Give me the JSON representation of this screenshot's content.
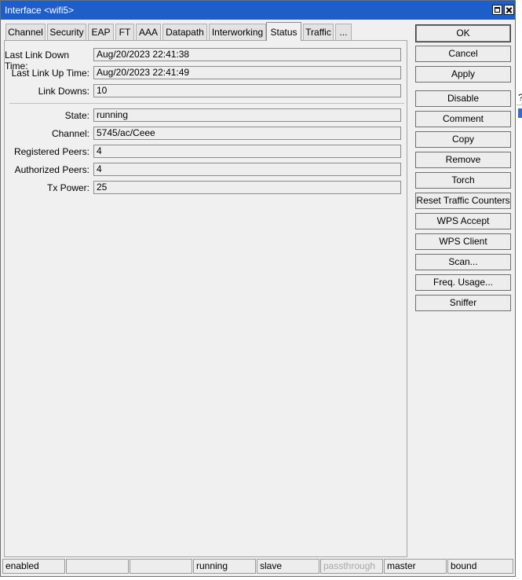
{
  "window": {
    "title": "Interface <wifi5>"
  },
  "tabs": [
    {
      "label": "Channel"
    },
    {
      "label": "Security"
    },
    {
      "label": "EAP"
    },
    {
      "label": "FT"
    },
    {
      "label": "AAA"
    },
    {
      "label": "Datapath"
    },
    {
      "label": "Interworking"
    },
    {
      "label": "Status"
    },
    {
      "label": "Traffic"
    },
    {
      "label": "..."
    }
  ],
  "active_tab": "Status",
  "status_fields": {
    "last_link_down_time": {
      "label": "Last Link Down Time:",
      "value": "Aug/20/2023 22:41:38"
    },
    "last_link_up_time": {
      "label": "Last Link Up Time:",
      "value": "Aug/20/2023 22:41:49"
    },
    "link_downs": {
      "label": "Link Downs:",
      "value": "10"
    },
    "state": {
      "label": "State:",
      "value": "running"
    },
    "channel": {
      "label": "Channel:",
      "value": "5745/ac/Ceee"
    },
    "registered_peers": {
      "label": "Registered Peers:",
      "value": "4"
    },
    "authorized_peers": {
      "label": "Authorized Peers:",
      "value": "4"
    },
    "tx_power": {
      "label": "Tx Power:",
      "value": "25"
    }
  },
  "buttons": [
    {
      "label": "OK"
    },
    {
      "label": "Cancel"
    },
    {
      "label": "Apply"
    },
    {
      "label": "Disable"
    },
    {
      "label": "Comment"
    },
    {
      "label": "Copy"
    },
    {
      "label": "Remove"
    },
    {
      "label": "Torch"
    },
    {
      "label": "Reset Traffic Counters"
    },
    {
      "label": "WPS Accept"
    },
    {
      "label": "WPS Client"
    },
    {
      "label": "Scan..."
    },
    {
      "label": "Freq. Usage..."
    },
    {
      "label": "Sniffer"
    }
  ],
  "statusbar": [
    {
      "text": "enabled"
    },
    {
      "text": ""
    },
    {
      "text": ""
    },
    {
      "text": "running"
    },
    {
      "text": "slave"
    },
    {
      "text": "passthrough",
      "disabled": true
    },
    {
      "text": "master"
    },
    {
      "text": "bound"
    }
  ],
  "background": {
    "partial_text": "?"
  },
  "colors": {
    "titlebar": "#1d5ec9",
    "window_bg": "#f0f0f0",
    "disabled_text": "#a8a8a8"
  }
}
